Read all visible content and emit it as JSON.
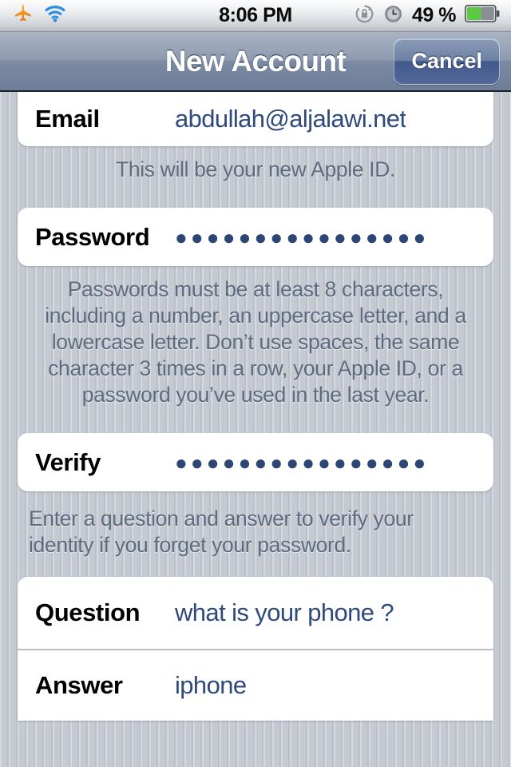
{
  "status_bar": {
    "airplane_icon": "airplane-icon",
    "wifi_icon": "wifi-icon",
    "time": "8:06 PM",
    "rotation_lock_icon": "rotation-lock-icon",
    "alarm_icon": "alarm-clock-icon",
    "battery_percent": "49 %",
    "battery_level": 49,
    "battery_color": "#5bc942"
  },
  "nav_bar": {
    "title": "New Account",
    "cancel_label": "Cancel"
  },
  "form": {
    "email": {
      "label": "Email",
      "value": "abdullah@aljalawi.net",
      "footnote": "This will be your new Apple ID."
    },
    "password": {
      "label": "Password",
      "masked_value": "●●●●●●●●●●●●●●●●",
      "dot_count": 16,
      "footnote": "Passwords must be at least 8 characters, including a number, an uppercase letter, and a lowercase letter. Don’t use spaces, the same character 3 times in a row, your Apple ID, or a password you’ve used in the last year."
    },
    "verify": {
      "label": "Verify",
      "masked_value": "●●●●●●●●●●●●●●●●",
      "dot_count": 16,
      "footnote": "Enter a question and answer to verify your identity if you forget your password."
    },
    "question": {
      "label": "Question",
      "value": "what is your phone ?"
    },
    "answer": {
      "label": "Answer",
      "value": "iphone"
    }
  },
  "colors": {
    "value_blue": "#2e4a7d",
    "footnote_gray": "#5e6a7d",
    "page_background": "#c5cad2",
    "nav_bar": "#7c8ba3"
  }
}
